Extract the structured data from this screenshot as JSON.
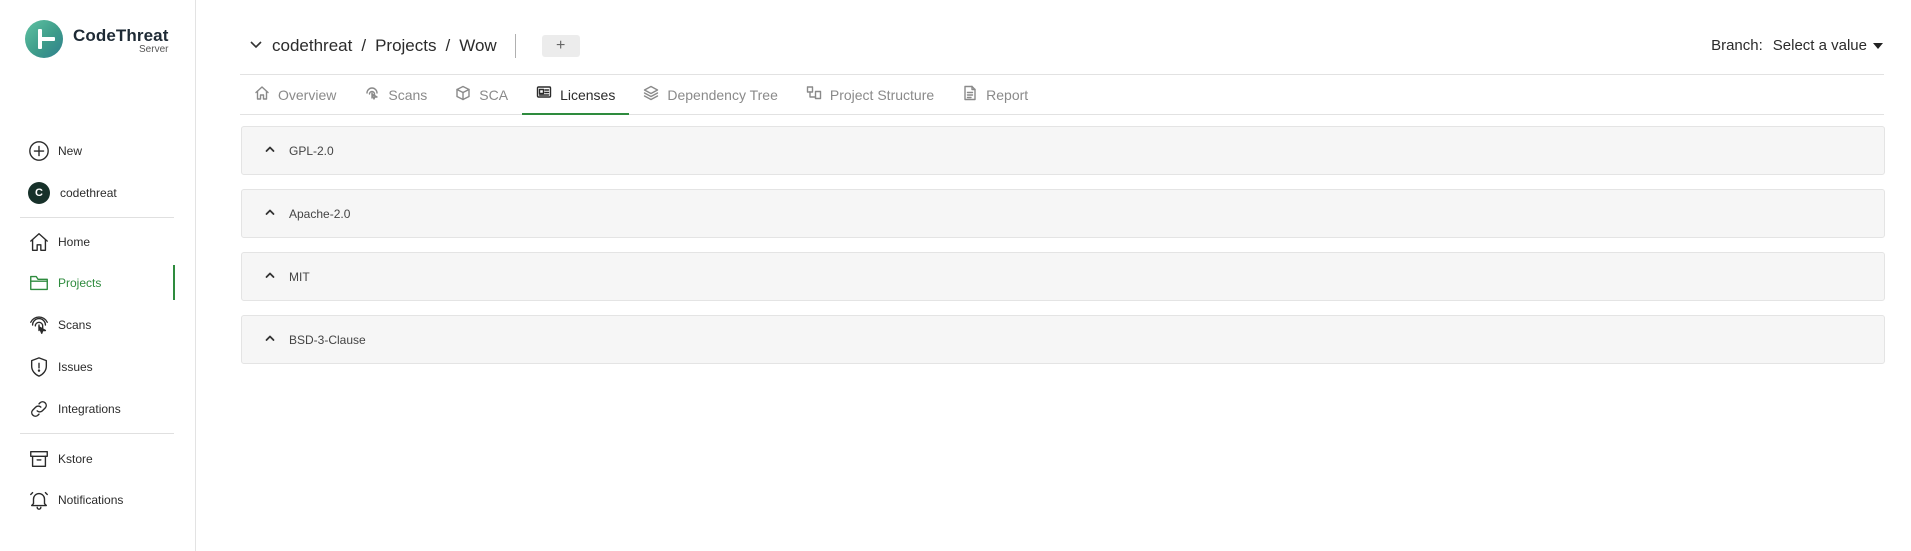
{
  "app": {
    "logo_title": "CodeThreat",
    "logo_subtitle": "Server"
  },
  "sidebar": {
    "new_label": "New",
    "org_initial": "C",
    "org_label": "codethreat",
    "items": [
      {
        "label": "Home",
        "icon": "home-icon"
      },
      {
        "label": "Projects",
        "icon": "folder-icon",
        "active": true
      },
      {
        "label": "Scans",
        "icon": "fingerprint-icon"
      },
      {
        "label": "Issues",
        "icon": "shield-icon"
      },
      {
        "label": "Integrations",
        "icon": "link-icon"
      }
    ],
    "lower_items": [
      {
        "label": "Kstore",
        "icon": "archive-icon"
      },
      {
        "label": "Notifications",
        "icon": "bell-icon"
      }
    ]
  },
  "header": {
    "breadcrumb": [
      "codethreat",
      "Projects",
      "Wow"
    ],
    "separator": "/",
    "add_label": "+",
    "branch_label": "Branch:",
    "branch_value": "Select a value"
  },
  "tabs": [
    {
      "label": "Overview",
      "icon": "home-icon"
    },
    {
      "label": "Scans",
      "icon": "fingerprint-icon"
    },
    {
      "label": "SCA",
      "icon": "cube-icon"
    },
    {
      "label": "Licenses",
      "icon": "id-card-icon",
      "active": true
    },
    {
      "label": "Dependency Tree",
      "icon": "layers-icon"
    },
    {
      "label": "Project Structure",
      "icon": "structure-icon"
    },
    {
      "label": "Report",
      "icon": "document-icon"
    }
  ],
  "licenses": [
    "GPL-2.0",
    "Apache-2.0",
    "MIT",
    "BSD-3-Clause"
  ],
  "colors": {
    "accent": "#2e8b3e",
    "panel_bg": "#f6f6f6",
    "avatar_bg": "#17312a"
  }
}
